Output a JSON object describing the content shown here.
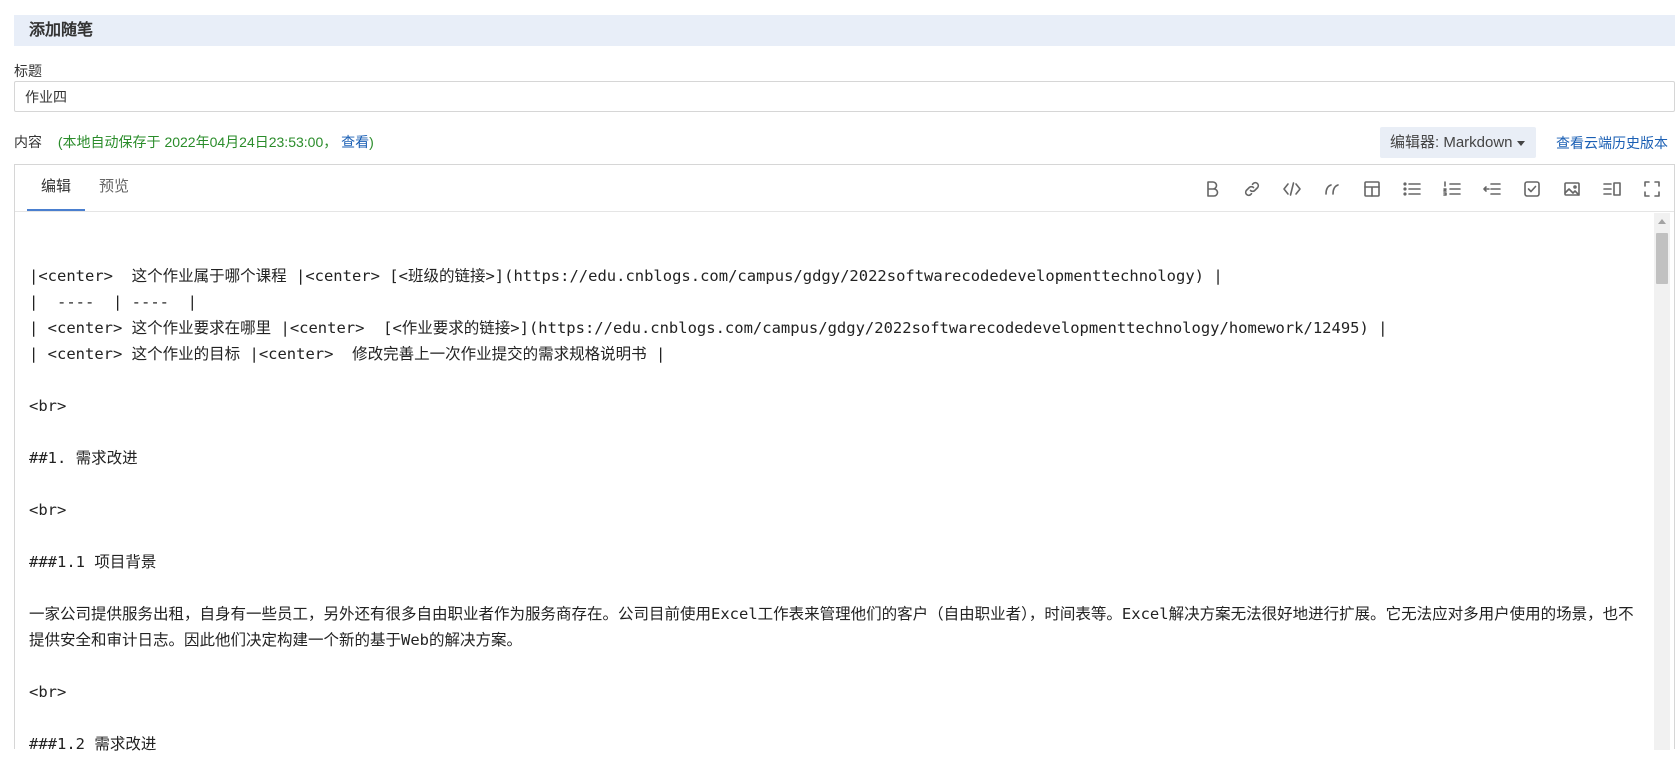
{
  "header": {
    "title": "添加随笔"
  },
  "title_field": {
    "label": "标题",
    "value": "作业四"
  },
  "content": {
    "label": "内容",
    "autosave_prefix": "(本地自动保存于 2022年04月24日23:53:00，",
    "autosave_link": "查看",
    "autosave_suffix": ")"
  },
  "editor_select": {
    "label": "编辑器: Markdown"
  },
  "history_link": "查看云端历史版本",
  "tabs": [
    {
      "label": "编辑"
    },
    {
      "label": "预览"
    }
  ],
  "toolbar": [
    "bold-icon",
    "link-icon",
    "code-icon",
    "quote-icon",
    "table-icon",
    "unordered-list-icon",
    "ordered-list-icon",
    "indent-icon",
    "checkbox-icon",
    "image-icon",
    "split-view-icon",
    "fullscreen-icon"
  ],
  "editor_lines": [
    "",
    "|<center>  这个作业属于哪个课程 |<center> [<班级的链接>](https://edu.cnblogs.com/campus/gdgy/2022softwarecodedevelopmenttechnology) |",
    "|  ----  | ----  |",
    "| <center> 这个作业要求在哪里 |<center>  [<作业要求的链接>](https://edu.cnblogs.com/campus/gdgy/2022softwarecodedevelopmenttechnology/homework/12495) |",
    "| <center> 这个作业的目标 |<center>  修改完善上一次作业提交的需求规格说明书 |",
    "",
    "<br>",
    "",
    "##1. 需求改进",
    "",
    "<br>",
    "",
    "###1.1 项目背景",
    "",
    "一家公司提供服务出租，自身有一些员工，另外还有很多自由职业者作为服务商存在。公司目前使用Excel工作表来管理他们的客户（自由职业者），时间表等。Excel解决方案无法很好地进行扩展。它无法应对多用户使用的场景，也不提供安全和审计日志。因此他们决定构建一个新的基于Web的解决方案。",
    "",
    "<br>",
    "",
    "###1.2 需求改进"
  ]
}
